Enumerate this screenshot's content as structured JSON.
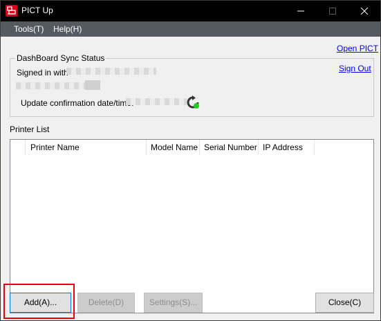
{
  "window": {
    "title": "PICT Up"
  },
  "menu": {
    "tools": "Tools(T)",
    "help": "Help(H)"
  },
  "links": {
    "open_pict": "Open PICT",
    "sign_out": "Sign Out"
  },
  "sync_status": {
    "group_label": "DashBoard Sync Status",
    "signed_in_label": "Signed in with",
    "update_label": "Update confirmation date/time:",
    "sync_icon": "refresh-sync-icon"
  },
  "printer_list": {
    "label": "Printer List",
    "columns": [
      "Printer Name",
      "Model Name",
      "Serial Number",
      "IP Address"
    ],
    "rows": []
  },
  "buttons": {
    "add": "Add(A)...",
    "delete": "Delete(D)",
    "settings": "Settings(S)...",
    "close": "Close(C)"
  },
  "colors": {
    "titlebar": "#000000",
    "menubar": "#555a60",
    "app_icon": "#d6001c",
    "link": "#0000ee",
    "highlight": "#e8000b",
    "sync_ok": "#22cc22"
  }
}
